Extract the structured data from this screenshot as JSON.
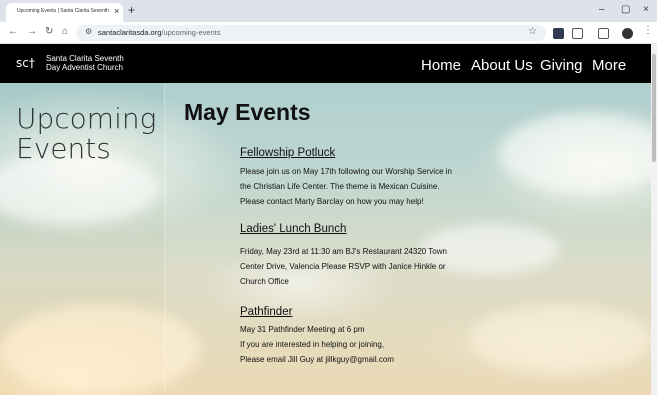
{
  "browser": {
    "tab_title": "Upcoming Events | Santa Clarita Seventh",
    "tab_close": "×",
    "new_tab": "+",
    "window_controls": {
      "minimize": "–",
      "maximize": "▢",
      "close": "×"
    },
    "nav": {
      "back": "←",
      "forward": "→",
      "reload": "↻",
      "home": "⌂"
    },
    "url_host": "santaclaritasda.org",
    "url_path": "/upcoming-events",
    "icons": [
      "site-info-icon",
      "star-icon",
      "extension-icon",
      "extensions-puzzle-icon",
      "reading-mode-icon",
      "profile-avatar-icon",
      "menu-icon"
    ]
  },
  "site": {
    "logo_mark": "sc†",
    "logo_line1": "Santa Clarita Seventh",
    "logo_line2": "Day Adventist Church",
    "nav": [
      "Home",
      "About Us",
      "Giving",
      "More"
    ]
  },
  "page": {
    "left_title_line1": "Upcoming",
    "left_title_line2": "Events",
    "main_title": "May Events",
    "events": [
      {
        "title": "Fellowship Potluck",
        "lines": [
          "Please join us on May 17th following our Worship Service in",
          "the Christian Life Center. The theme is Mexican Cuisine.",
          "Please contact Marty Barclay on how you may help!"
        ]
      },
      {
        "title": "Ladies' Lunch Bunch",
        "lines": [
          "Friday, May 23rd at 11:30 am BJ's Restaurant 24320 Town",
          "Center Drive, Valencia Please RSVP with Janice Hinkle or",
          "Church Office"
        ]
      },
      {
        "title": "Pathfinder",
        "lines": [
          "May 31 Pathfinder Meeting at 6 pm",
          "If you are interested in helping or joining,",
          "Please email Jill Guy at jillkguy@gmail.com"
        ]
      }
    ]
  }
}
